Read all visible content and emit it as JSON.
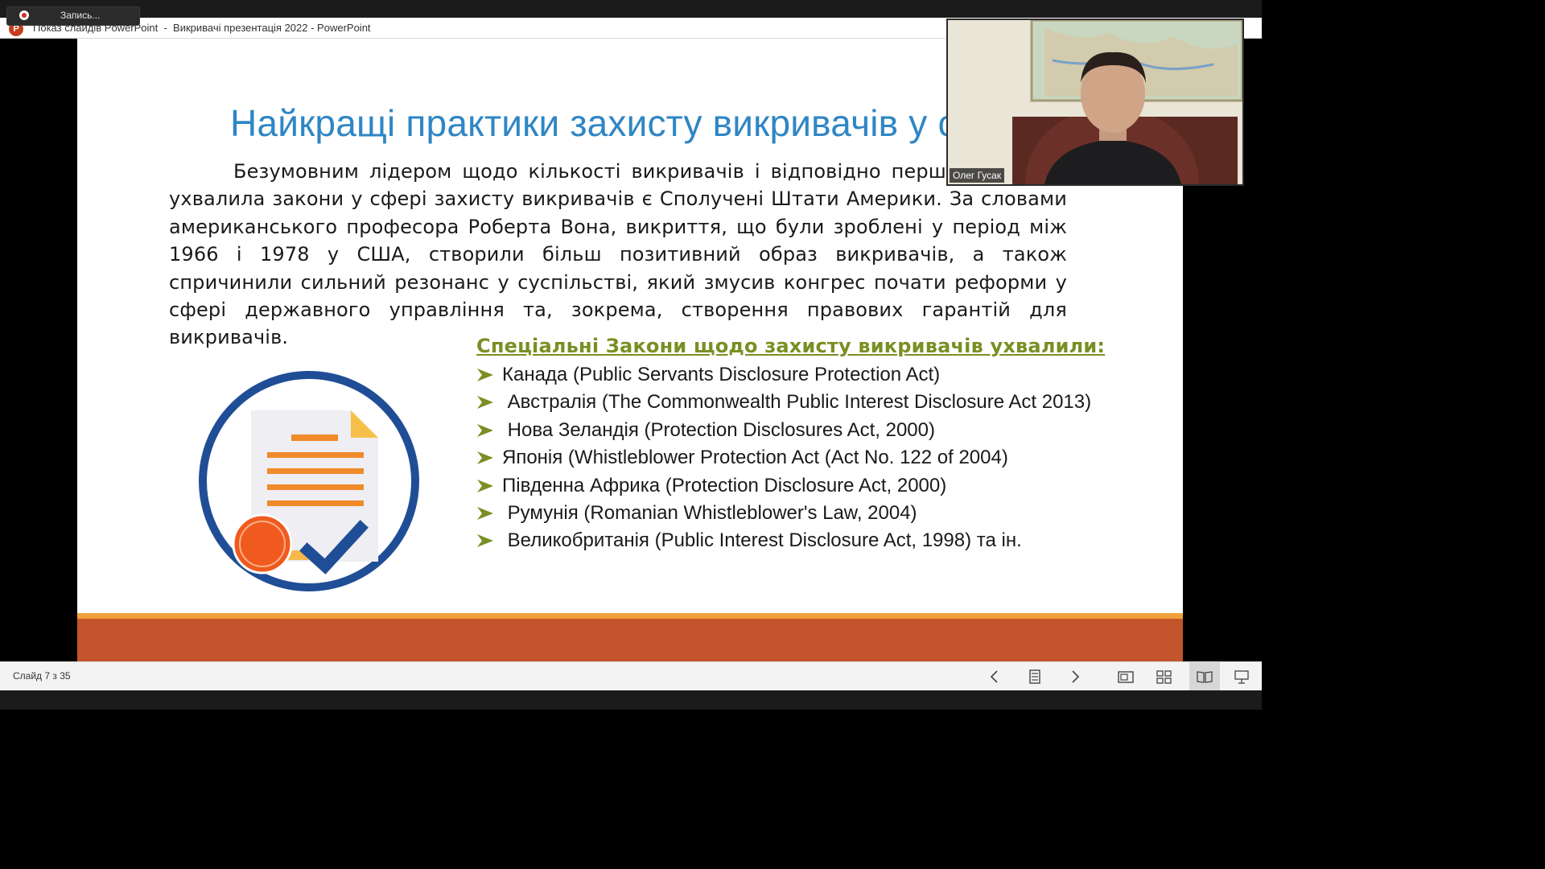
{
  "recording": {
    "label": "Запись..."
  },
  "window": {
    "title": "Показ слайдів PowerPoint  -  Викривачі презентація 2022 - PowerPoint",
    "app_icon_letter": "P"
  },
  "slide": {
    "title": "Найкращі практики захисту викривачів у св",
    "paragraph": "Безумовним лідером щодо кількості викривачів і відповідно першою кра яка ухвалила закони у сфері захисту викривачів є Сполучені Штати Америки. За словами американського професора Роберта Вона, викриття, що були зроблені у період між 1966 і 1978 у США, створили більш позитивний образ викривачів, а також спричинили сильний резонанс у суспільстві, який змусив конгрес почати реформи у сфері державного управління та, зокрема, створення правових гарантій для викривачів.",
    "laws_heading": "Спеціальні Закони щодо захисту викривачів ухвалили:",
    "laws": [
      "Канада (Public Servants Disclosure Protection Act)",
      " Австралія (The Commonwealth Public Interest Disclosure Act 2013)",
      " Нова Зеландія (Protection Disclosures Act, 2000)",
      "Японія (Whistleblower Protection Act (Act No. 122 of 2004)",
      "Південна Африка (Protection Disclosure Act, 2000)",
      " Румунія (Romanian Whistleblower's Law, 2004)",
      " Великобританія (Public Interest Disclosure Act, 1998) та ін."
    ],
    "colors": {
      "title": "#2f86c4",
      "heading": "#7a8f23",
      "arrow": "#7a8f23",
      "footer_band": "#c4542b",
      "footer_line": "#f0a13a",
      "ring": "#1f4e96"
    }
  },
  "webcam": {
    "participant_name": "Олег Гусак"
  },
  "statusbar": {
    "slide_counter": "Слайд 7 з 35",
    "controls": [
      "prev-icon",
      "slide-list-icon",
      "next-icon",
      "normal-view-icon",
      "sorter-view-icon",
      "reading-view-icon",
      "presenter-view-icon"
    ],
    "active_view": "reading-view-icon"
  }
}
